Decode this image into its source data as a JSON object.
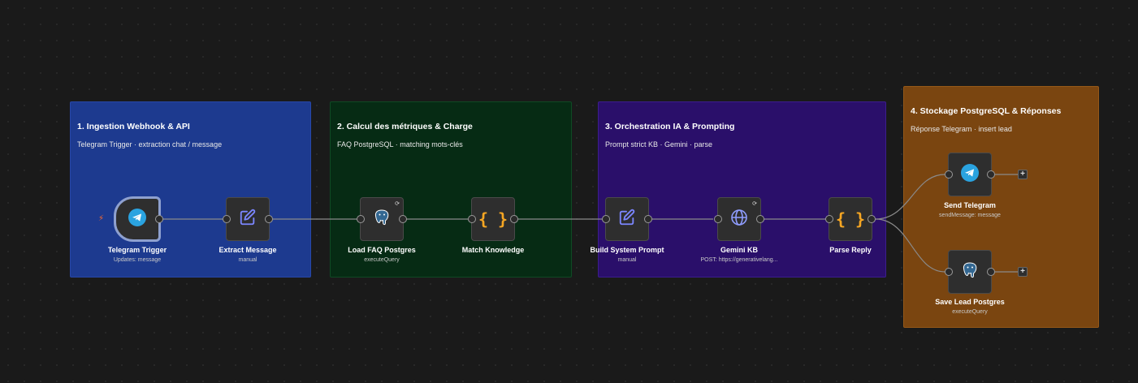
{
  "groups": [
    {
      "title": "1. Ingestion Webhook & API",
      "subtitle": "Telegram Trigger · extraction chat / message",
      "color": "#1d3a8f"
    },
    {
      "title": "2. Calcul des métriques & Charge",
      "subtitle": "FAQ PostgreSQL · matching mots-clés",
      "color": "#062b14"
    },
    {
      "title": "3. Orchestration IA & Prompting",
      "subtitle": "Prompt strict KB · Gemini · parse",
      "color": "#2a0f6a"
    },
    {
      "title": "4. Stockage PostgreSQL & Réponses",
      "subtitle": "Réponse Telegram · insert lead",
      "color": "#7a4510"
    }
  ],
  "nodes": {
    "telegram_trigger": {
      "label": "Telegram Trigger",
      "sub": "Updates: message",
      "icon": "telegram-icon"
    },
    "extract_message": {
      "label": "Extract Message",
      "sub": "manual",
      "icon": "edit-icon"
    },
    "load_faq": {
      "label": "Load FAQ Postgres",
      "sub": "executeQuery",
      "icon": "postgres-icon"
    },
    "match_knowledge": {
      "label": "Match Knowledge",
      "sub": "",
      "icon": "code-braces-icon"
    },
    "build_prompt": {
      "label": "Build System Prompt",
      "sub": "manual",
      "icon": "edit-icon"
    },
    "gemini_kb": {
      "label": "Gemini KB",
      "sub": "POST: https://generativelang...",
      "icon": "globe-icon"
    },
    "parse_reply": {
      "label": "Parse Reply",
      "sub": "",
      "icon": "code-braces-icon"
    },
    "send_telegram": {
      "label": "Send Telegram",
      "sub": "sendMessage: message",
      "icon": "telegram-icon"
    },
    "save_lead": {
      "label": "Save Lead Postgres",
      "sub": "executeQuery",
      "icon": "postgres-icon"
    }
  },
  "plus_symbol": "+",
  "colors": {
    "telegram": "#2aa3e0",
    "edit": "#7b86ff",
    "braces": "#f5a623",
    "postgres": "#336791",
    "edge": "#8a8a8a"
  }
}
